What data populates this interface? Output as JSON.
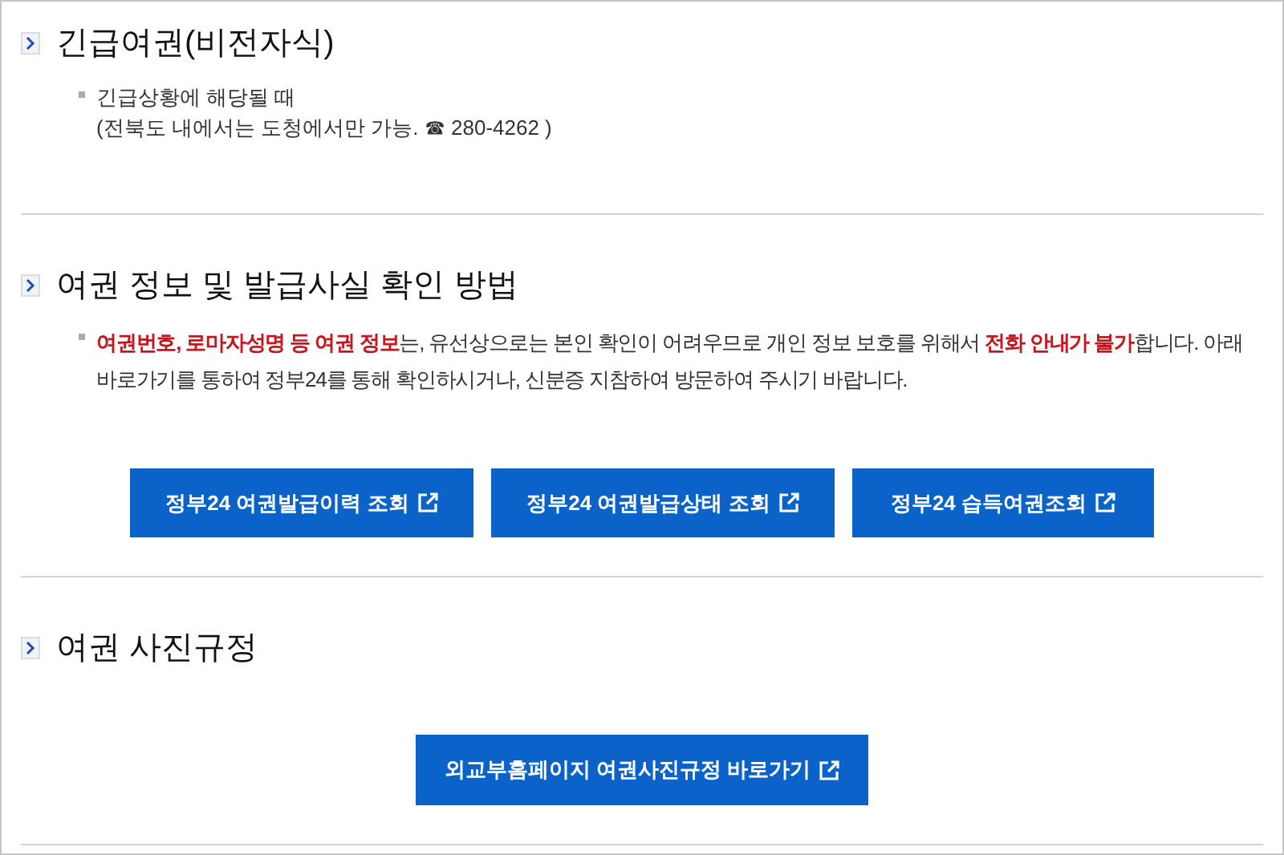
{
  "sections": [
    {
      "title": "긴급여권(비전자식)",
      "notes": [
        {
          "lines": [
            "긴급상황에 해당될 때",
            "(전북도 내에서는 도청에서만 가능. ☎ 280-4262 )"
          ]
        }
      ]
    },
    {
      "title": "여권 정보 및 발급사실 확인 방법",
      "notes": [
        {
          "segments": [
            {
              "text": "여권번호, 로마자성명 등 여권 정보",
              "emphasis": true
            },
            {
              "text": "는, 유선상으로는 본인 확인이 어려우므로 개인 정보 보호를 위해서 ",
              "emphasis": false
            },
            {
              "text": "전화 안내가 불가",
              "emphasis": true
            },
            {
              "text": "합니다. 아래 바로가기를 통하여 정부24를 통해 확인하시거나, 신분증 지참하여 방문하여 주시기 바랍니다.",
              "emphasis": false
            }
          ]
        }
      ],
      "buttons": [
        "정부24 여권발급이력 조회",
        "정부24 여권발급상태 조회",
        "정부24 습득여권조회"
      ]
    },
    {
      "title": "여권 사진규정",
      "buttons": [
        "외교부홈페이지 여권사진규정 바로가기"
      ]
    }
  ]
}
